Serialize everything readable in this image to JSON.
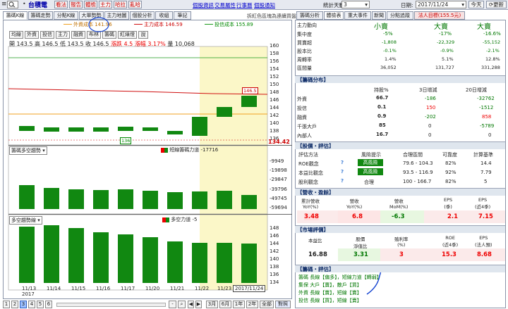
{
  "topbar": {
    "menu_icon": "≡",
    "search_icon": "search-icon",
    "stock_code": "•",
    "stock_name": "台積電",
    "buttons": [
      "看法",
      "報告",
      "體檢",
      "主力",
      "哈拉",
      "亂哈"
    ],
    "links": [
      "個股資訊",
      "交易屬性",
      "行事曆",
      "個股通知"
    ],
    "period_label": "統計天數:",
    "period_value": "3",
    "date_label": "日期:",
    "date_value": "2017/11/24",
    "today_button": "今天",
    "refresh_button": "更新"
  },
  "left_tabs": [
    "籌碼K線",
    "籌碼走勢",
    "分點K線",
    "大單勢勢",
    "主力地圖",
    "個股分析",
    "收組",
    "筆記"
  ],
  "left_tab_note": "拆紅色區塊為連續買盤",
  "legend": {
    "foreign": "外資成本 141.96",
    "main": "主力成本 146.59",
    "trust": "投信成本 155.89"
  },
  "tools": [
    "均線",
    "外資",
    "投信",
    "主力",
    "融資",
    "布林",
    "籌碼",
    "紅綠燈",
    "說"
  ],
  "ohlc": {
    "open": "開 143.5",
    "high": "高 146.5",
    "low": "低 143.5",
    "close": "收 146.5",
    "change": "漲跌 4.5",
    "pct": "漲幅 3.17%",
    "vol": "量 10,068"
  },
  "price_axis": [
    "160",
    "158",
    "156",
    "154",
    "152",
    "150",
    "148",
    "146",
    "144",
    "142",
    "140",
    "138",
    "136"
  ],
  "price_last": "134.42",
  "label_146": "146.5",
  "label_136": "136",
  "panel2": {
    "title": "籌碼多空趨勢",
    "legend": "短線籌碼力道 -17716",
    "axis": [
      "-9949",
      "-19898",
      "-29847",
      "-39796",
      "-49745",
      "-59694"
    ]
  },
  "panel3": {
    "title": "多空趨勢線",
    "legend": "多空力道 -5",
    "axis": [
      "148",
      "146",
      "144",
      "142",
      "140",
      "138",
      "136",
      "134"
    ]
  },
  "x_axis": [
    "11/13",
    "11/14",
    "11/15",
    "11/16",
    "11/17",
    "11/20",
    "11/21",
    "11/22",
    "11/23"
  ],
  "x_year": "2017",
  "x_sel": "2017/11/24",
  "pager": [
    "1",
    "2",
    "3",
    "4",
    "5",
    "6"
  ],
  "bottom": {
    "period_buttons": [
      "3月",
      "6月",
      "1年",
      "2年",
      "全部",
      "對照"
    ]
  },
  "right_tabs": [
    "籌碼分析",
    "體檢表",
    "重大事件",
    "新聞",
    "分點追蹤",
    "法人目標(155.5元)"
  ],
  "trend": {
    "label": "主力動向",
    "cols": [
      "小賣",
      "大賣",
      "大賣"
    ]
  },
  "trend_rows": [
    {
      "label": "集中度",
      "v": [
        "-5%",
        "-17%",
        "-16.6%"
      ]
    },
    {
      "label": "買賣超",
      "v": [
        "-1,808",
        "-22,329",
        "-55,152"
      ]
    },
    {
      "label": "股本比",
      "v": [
        "-0.1%",
        "-0.9%",
        "-2.1%"
      ]
    },
    {
      "label": "周轉率",
      "v": [
        "1.4%",
        "5.1%",
        "12.8%"
      ]
    },
    {
      "label": "區間量",
      "v": [
        "36,052",
        "131,727",
        "331,288"
      ]
    }
  ],
  "dist": {
    "title": "【籌碼分布】",
    "cols": [
      "持股%",
      "3日增減",
      "20日增減"
    ],
    "rows": [
      {
        "label": "外資",
        "v": [
          "66.7",
          "-186",
          "-32762"
        ]
      },
      {
        "label": "投信",
        "v": [
          "0.1",
          "150",
          "-1512"
        ]
      },
      {
        "label": "融資",
        "v": [
          "0.9",
          "-202",
          "858"
        ]
      },
      {
        "label": "千張大戶",
        "v": [
          "85",
          "0",
          "-5789"
        ]
      },
      {
        "label": "內部人",
        "v": [
          "16.7",
          "0",
          "0"
        ]
      }
    ]
  },
  "valuation": {
    "title": "【股價・評估】",
    "cols": [
      "評估方法",
      "風險提示",
      "合理區間",
      "可靠度",
      "計算基準"
    ],
    "rows": [
      {
        "label": "ROE觀念",
        "risk": "高風險",
        "range": "79.6 - 104.3",
        "rel": "82%",
        "base": "14.4"
      },
      {
        "label": "本益比觀念",
        "risk": "高風險",
        "range": "93.5 - 116.9",
        "rel": "92%",
        "base": "7.79"
      },
      {
        "label": "股利觀念",
        "risk": "合理",
        "range": "100 - 166.7",
        "rel": "82%",
        "base": "5"
      }
    ]
  },
  "revenue": {
    "title": "【營收・盈餘】",
    "cols": [
      "累計營收\nYoY(%)",
      "營收\nYoY(%)",
      "營收\nMoM(%)",
      "EPS\n(季)",
      "EPS\n(近4季)"
    ],
    "v": [
      "3.48",
      "6.8",
      "-6.3",
      "2.1",
      "7.15"
    ]
  },
  "market": {
    "title": "【市場評價】",
    "cols": [
      "本益比",
      "股價\n淨值比",
      "殖利率\n(%)",
      "ROE\n(近4季)",
      "EPS\n(法人預)"
    ],
    "v": [
      "16.88",
      "3.31",
      "3",
      "15.3",
      "8.68"
    ]
  },
  "chip_eval": {
    "title": "【籌碼・評估】",
    "lines": [
      "籌碼 長線【偏多】，短線力道【轉弱】",
      "集保 大戶【賣】，散戶【買】",
      "外資 長線【賣】，短線【賣】",
      "投信 長線【買】，短線【賣】"
    ]
  },
  "colors": {
    "up": "#e60000",
    "down": "#118811",
    "highlight": "#fbf7c8",
    "foreign": "#f0a020",
    "main": "#d01010",
    "trust": "#1a9a1a"
  }
}
